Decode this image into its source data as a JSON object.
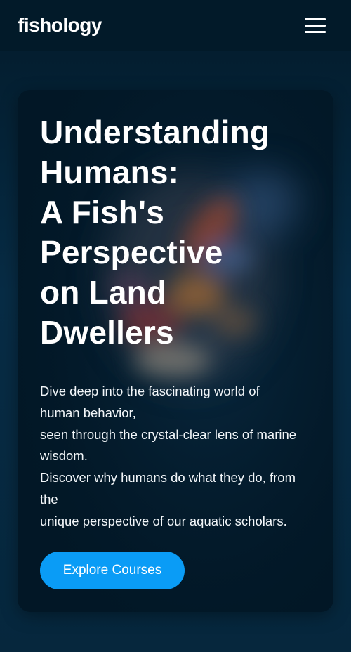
{
  "header": {
    "logo_text": "fishology",
    "menu_icon": "hamburger-menu-icon"
  },
  "hero": {
    "title_lines": [
      "Understanding",
      "Humans:",
      "A Fish's",
      "Perspective",
      "on Land",
      "Dwellers"
    ],
    "description_lines": [
      "Dive deep into the fascinating world of",
      "human behavior,",
      "seen through the crystal-clear lens of marine",
      "wisdom.",
      "Discover why humans do what they do, from",
      "the",
      "unique perspective of our aquatic scholars."
    ],
    "cta_label": "Explore Courses",
    "background_image": "blurred-fish-image"
  },
  "colors": {
    "page_background": "#06263b",
    "navbar_background": "#021a29",
    "card_background": "#021726",
    "accent": "#0a9cf6",
    "text": "#ffffff"
  }
}
